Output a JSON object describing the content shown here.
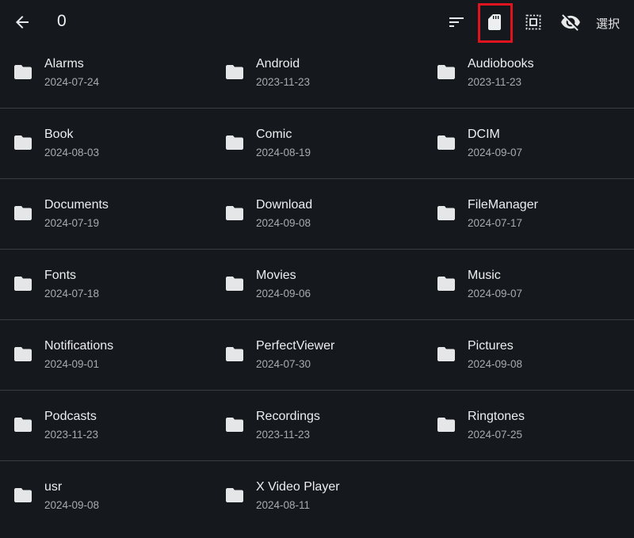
{
  "header": {
    "title": "0",
    "select_label": "選択",
    "icons": {
      "back": "arrow-back-icon",
      "sort": "sort-icon",
      "storage": "sd-card-icon",
      "select_all": "select-all-icon",
      "hide": "eye-off-icon"
    },
    "highlight_color": "#e0141e"
  },
  "folders": [
    [
      {
        "name": "Alarms",
        "date": "2024-07-24"
      },
      {
        "name": "Android",
        "date": "2023-11-23"
      },
      {
        "name": "Audiobooks",
        "date": "2023-11-23"
      }
    ],
    [
      {
        "name": "Book",
        "date": "2024-08-03"
      },
      {
        "name": "Comic",
        "date": "2024-08-19"
      },
      {
        "name": "DCIM",
        "date": "2024-09-07"
      }
    ],
    [
      {
        "name": "Documents",
        "date": "2024-07-19"
      },
      {
        "name": "Download",
        "date": "2024-09-08"
      },
      {
        "name": "FileManager",
        "date": "2024-07-17"
      }
    ],
    [
      {
        "name": "Fonts",
        "date": "2024-07-18"
      },
      {
        "name": "Movies",
        "date": "2024-09-06"
      },
      {
        "name": "Music",
        "date": "2024-09-07"
      }
    ],
    [
      {
        "name": "Notifications",
        "date": "2024-09-01"
      },
      {
        "name": "PerfectViewer",
        "date": "2024-07-30"
      },
      {
        "name": "Pictures",
        "date": "2024-09-08"
      }
    ],
    [
      {
        "name": "Podcasts",
        "date": "2023-11-23"
      },
      {
        "name": "Recordings",
        "date": "2023-11-23"
      },
      {
        "name": "Ringtones",
        "date": "2024-07-25"
      }
    ],
    [
      {
        "name": "usr",
        "date": "2024-09-08"
      },
      {
        "name": "X Video Player",
        "date": "2024-08-11"
      }
    ]
  ]
}
